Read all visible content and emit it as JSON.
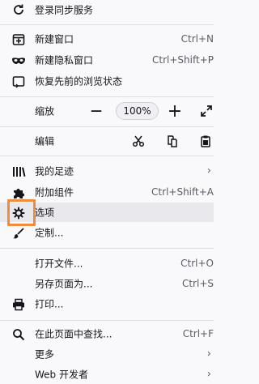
{
  "menu": {
    "sync": {
      "label": "登录同步服务",
      "icon": "sync-icon"
    },
    "new_window": {
      "label": "新建窗口",
      "shortcut": "Ctrl+N",
      "icon": "new-window-icon"
    },
    "new_private": {
      "label": "新建隐私窗口",
      "shortcut": "Ctrl+Shift+P",
      "icon": "private-mask-icon"
    },
    "restore_session": {
      "label": "恢复先前的浏览状态",
      "icon": "restore-session-icon"
    },
    "zoom": {
      "label": "缩放",
      "minus": "—",
      "value": "100%",
      "plus": "+",
      "fullscreen_icon": "fullscreen-icon"
    },
    "edit": {
      "label": "编辑",
      "cut_icon": "scissors-icon",
      "copy_icon": "copy-icon",
      "paste_icon": "paste-icon"
    },
    "library": {
      "label": "我的足迹",
      "icon": "library-icon",
      "chevron": "›"
    },
    "addons": {
      "label": "附加组件",
      "shortcut": "Ctrl+Shift+A",
      "icon": "puzzle-icon"
    },
    "options": {
      "label": "选项",
      "icon": "gear-icon",
      "highlight_color": "#f08a3c"
    },
    "customize": {
      "label": "定制...",
      "icon": "paintbrush-icon"
    },
    "open_file": {
      "label": "打开文件...",
      "shortcut": "Ctrl+O"
    },
    "save_as": {
      "label": "另存页面为...",
      "shortcut": "Ctrl+S"
    },
    "print": {
      "label": "打印...",
      "icon": "printer-icon"
    },
    "find": {
      "label": "在此页面中查找...",
      "shortcut": "Ctrl+F",
      "icon": "search-icon"
    },
    "more": {
      "label": "更多",
      "chevron": "›"
    },
    "web_dev": {
      "label": "Web 开发者",
      "chevron": "›"
    }
  },
  "colors": {
    "background": "#f9f9fb",
    "separator": "#dddde1",
    "accent": "#f08a3c"
  }
}
